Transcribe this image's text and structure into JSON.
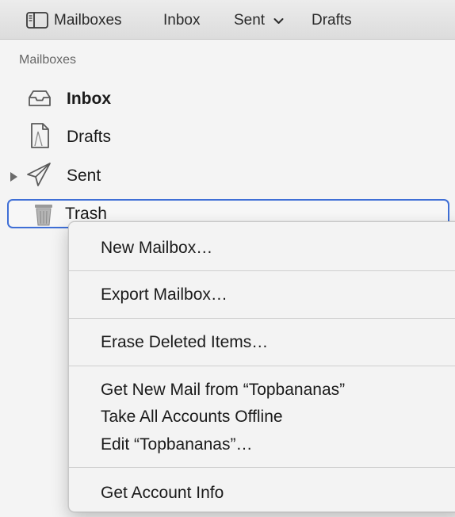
{
  "toolbar": {
    "sidebar_toggle_icon": "sidebar-icon",
    "mailboxes_label": "Mailboxes",
    "inbox_label": "Inbox",
    "sent_label": "Sent",
    "sent_chevron_icon": "chevron-down-icon",
    "drafts_label": "Drafts"
  },
  "sidebar": {
    "section_header": "Mailboxes",
    "items": [
      {
        "label": "Inbox",
        "icon": "inbox-tray-icon"
      },
      {
        "label": "Drafts",
        "icon": "document-icon"
      },
      {
        "label": "Sent",
        "icon": "paper-plane-icon",
        "expandable": true
      },
      {
        "label": "Trash",
        "icon": "trash-can-icon",
        "selected": true
      }
    ]
  },
  "context_menu": {
    "groups": [
      [
        "New Mailbox…"
      ],
      [
        "Export Mailbox…"
      ],
      [
        "Erase Deleted Items…"
      ],
      [
        "Get New Mail from “Topbananas”",
        "Take All Accounts Offline",
        "Edit “Topbananas”…"
      ],
      [
        "Get Account Info"
      ]
    ]
  },
  "colors": {
    "selection_outline": "#3f6fd6",
    "sidebar_background": "#f4f4f4",
    "menu_background": "#f3f3f3"
  }
}
